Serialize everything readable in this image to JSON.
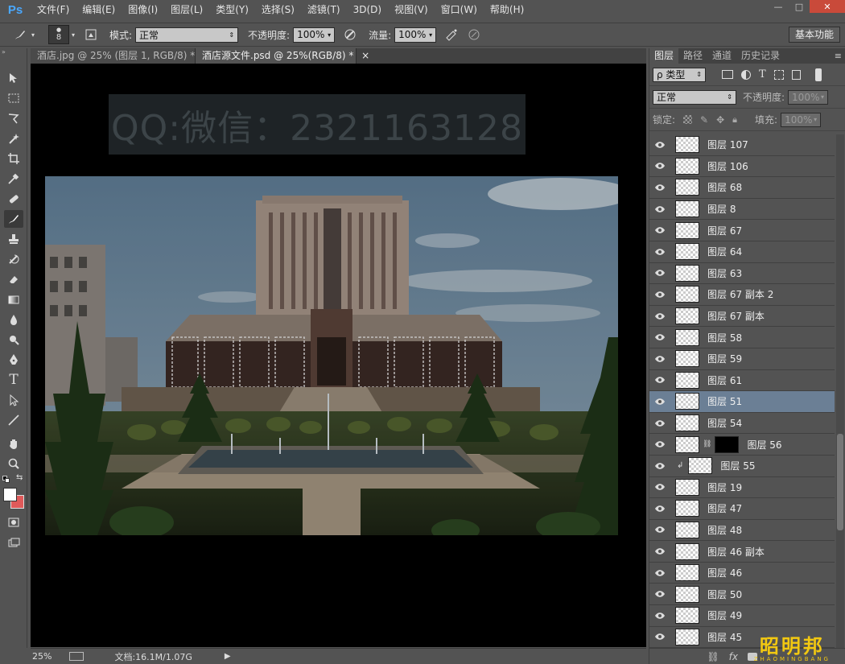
{
  "app": {
    "logo": "Ps"
  },
  "menu": [
    "文件(F)",
    "编辑(E)",
    "图像(I)",
    "图层(L)",
    "类型(Y)",
    "选择(S)",
    "滤镜(T)",
    "3D(D)",
    "视图(V)",
    "窗口(W)",
    "帮助(H)"
  ],
  "window_controls": {
    "minimize": "—",
    "restore": "□",
    "close": "✕"
  },
  "options": {
    "brush_size": "8",
    "mode_label": "模式:",
    "mode_value": "正常",
    "opacity_label": "不透明度:",
    "opacity_value": "100%",
    "flow_label": "流量:",
    "flow_value": "100%",
    "workspace": "基本功能"
  },
  "tabs": [
    {
      "label": "酒店.jpg @ 25% (图层 1, RGB/8) *",
      "close": "×"
    },
    {
      "label": "酒店源文件.psd @ 25%(RGB/8) *",
      "close": "×"
    }
  ],
  "canvas": {
    "watermark": "QQ:微信：2321163128"
  },
  "status": {
    "zoom": "25%",
    "doc": "文档:16.1M/1.07G"
  },
  "panel": {
    "tabs": [
      "图层",
      "路径",
      "通道",
      "历史记录"
    ],
    "filter_label": "ρ 类型",
    "blend_mode": "正常",
    "opacity_label": "不透明度:",
    "opacity_value": "100%",
    "lock_label": "锁定:",
    "fill_label": "填充:",
    "fill_value": "100%"
  },
  "layers": [
    {
      "name": "图层 107"
    },
    {
      "name": "图层 106"
    },
    {
      "name": "图层 68"
    },
    {
      "name": "图层 8"
    },
    {
      "name": "图层 67"
    },
    {
      "name": "图层 64"
    },
    {
      "name": "图层 63"
    },
    {
      "name": "图层 67 副本 2"
    },
    {
      "name": "图层 67 副本"
    },
    {
      "name": "图层 58"
    },
    {
      "name": "图层 59"
    },
    {
      "name": "图层 61"
    },
    {
      "name": "图层 51",
      "selected": true
    },
    {
      "name": "图层 54"
    },
    {
      "name": "图层 56",
      "mask": true
    },
    {
      "name": "图层 55",
      "clipped": true
    },
    {
      "name": "图层 19"
    },
    {
      "name": "图层 47"
    },
    {
      "name": "图层 48"
    },
    {
      "name": "图层 46 副本"
    },
    {
      "name": "图层 46"
    },
    {
      "name": "图层 50"
    },
    {
      "name": "图层 49"
    },
    {
      "name": "图层 45"
    }
  ],
  "footer_icons": [
    "link-icon",
    "fx-icon",
    "mask-icon"
  ],
  "brand": {
    "main": "昭明邦",
    "sub": "ZHAOMINGBANG"
  },
  "colors": {
    "fg": "#ffffff",
    "bg": "#e05a5a",
    "selection": "#6b7f95"
  }
}
